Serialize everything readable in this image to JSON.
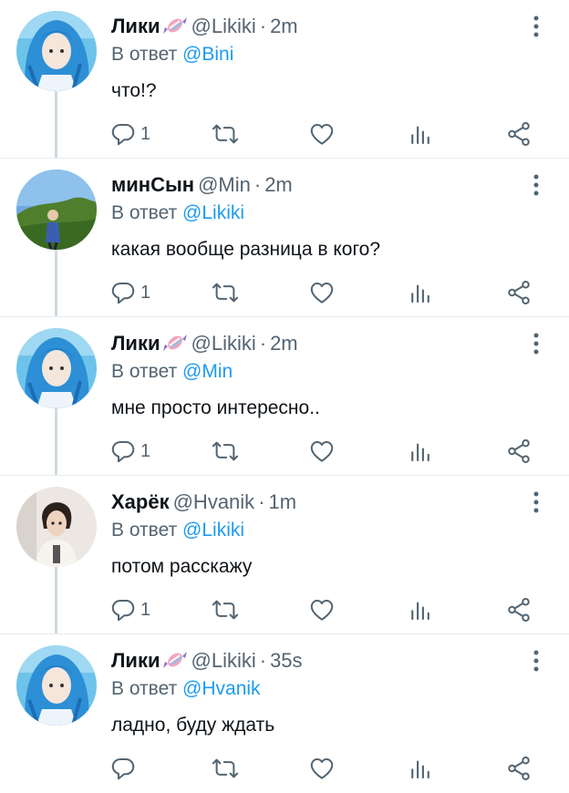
{
  "colors": {
    "mention": "#1d9bf0",
    "secondary_text": "#536471",
    "primary_text": "#0f1419",
    "thread_line": "#cfd9de"
  },
  "tweets": [
    {
      "name": "Лики",
      "badge_icon": "candy-icon",
      "handle": "@Likiki",
      "dot": "·",
      "time": "2m",
      "reply_prefix": "В ответ",
      "reply_to": "@Bini",
      "text": "что!?",
      "reply_count": "1",
      "avatar": "blue-hair-avatar"
    },
    {
      "name": "минСын",
      "badge_icon": "",
      "handle": "@Min",
      "dot": "·",
      "time": "2m",
      "reply_prefix": "В ответ",
      "reply_to": "@Likiki",
      "text": "какая вообще разница в кого?",
      "reply_count": "1",
      "avatar": "landscape-avatar"
    },
    {
      "name": "Лики",
      "badge_icon": "candy-icon",
      "handle": "@Likiki",
      "dot": "·",
      "time": "2m",
      "reply_prefix": "В ответ",
      "reply_to": "@Min",
      "text": "мне просто интересно..",
      "reply_count": "1",
      "avatar": "blue-hair-avatar"
    },
    {
      "name": "Харёк",
      "badge_icon": "",
      "handle": "@Hvanik",
      "dot": "·",
      "time": "1m",
      "reply_prefix": "В ответ",
      "reply_to": "@Likiki",
      "text": "потом расскажу",
      "reply_count": "1",
      "avatar": "portrait-avatar"
    },
    {
      "name": "Лики",
      "badge_icon": "candy-icon",
      "handle": "@Likiki",
      "dot": "·",
      "time": "35s",
      "reply_prefix": "В ответ",
      "reply_to": "@Hvanik",
      "text": "ладно, буду ждать",
      "reply_count": "",
      "avatar": "blue-hair-avatar"
    }
  ]
}
